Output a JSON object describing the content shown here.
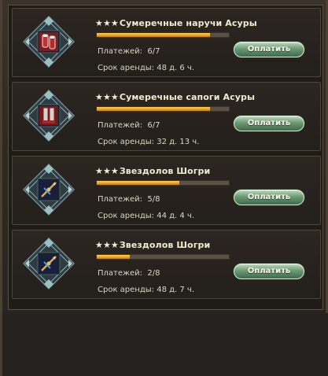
{
  "rental": {
    "items": [
      {
        "stars": "★★★",
        "name": "Сумеречные наручи Асуры",
        "payments_label": "Платежей:",
        "payments": "6/7",
        "progress": 0.857,
        "term_label": "Срок аренды:",
        "term": "48 д. 6 ч.",
        "button": "Оплатить",
        "icon": "bracers-icon"
      },
      {
        "stars": "★★★",
        "name": "Сумеречные сапоги Асуры",
        "payments_label": "Платежей:",
        "payments": "6/7",
        "progress": 0.857,
        "term_label": "Срок аренды:",
        "term": "32 д. 13 ч.",
        "button": "Оплатить",
        "icon": "boots-icon"
      },
      {
        "stars": "★★★",
        "name": "Звездолов Шогри",
        "payments_label": "Платежей:",
        "payments": "5/8",
        "progress": 0.625,
        "term_label": "Срок аренды:",
        "term": "44 д. 4 ч.",
        "button": "Оплатить",
        "icon": "crossbow-icon"
      },
      {
        "stars": "★★★",
        "name": "Звездолов Шогри",
        "payments_label": "Платежей:",
        "payments": "2/8",
        "progress": 0.25,
        "term_label": "Срок аренды:",
        "term": "48 д. 7 ч.",
        "button": "Оплатить",
        "icon": "crossbow-icon"
      }
    ]
  },
  "colors": {
    "progress_fill": "#f0a81e",
    "button_green": "#6d9a74",
    "text": "#ddd6c2"
  }
}
